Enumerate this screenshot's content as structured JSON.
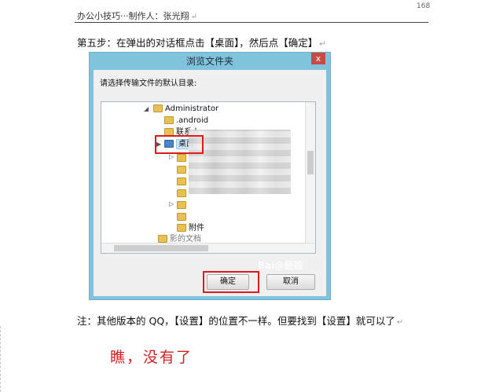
{
  "header": {
    "text": "办公小技巧···制作人：张光翔",
    "page_number": "168"
  },
  "step_text": "第五步：在弹出的对话框点击【桌面】，然后点【确定】",
  "dialog": {
    "title": "浏览文件夹",
    "close_label": "x",
    "prompt": "请选择传输文件的默认目录:",
    "tree": [
      {
        "label": "Administrator",
        "expander": "◢"
      },
      {
        "label": ".android"
      },
      {
        "label": "联系人"
      },
      {
        "label": "桌面",
        "expander": "▶"
      },
      {
        "label": "附件"
      },
      {
        "label": "影的文档"
      }
    ],
    "ok_label": "确定",
    "cancel_label": "取消",
    "watermark": "Bai@经验"
  },
  "note_text": "注：其他版本的 QQ，【设置】的位置不一样。但要找到【设置】就可以了",
  "red_note": "瞧，没有了",
  "colors": {
    "highlight_red": "#e0191b",
    "note_red": "#d42020",
    "dialog_frame": "#7fc4dc"
  }
}
